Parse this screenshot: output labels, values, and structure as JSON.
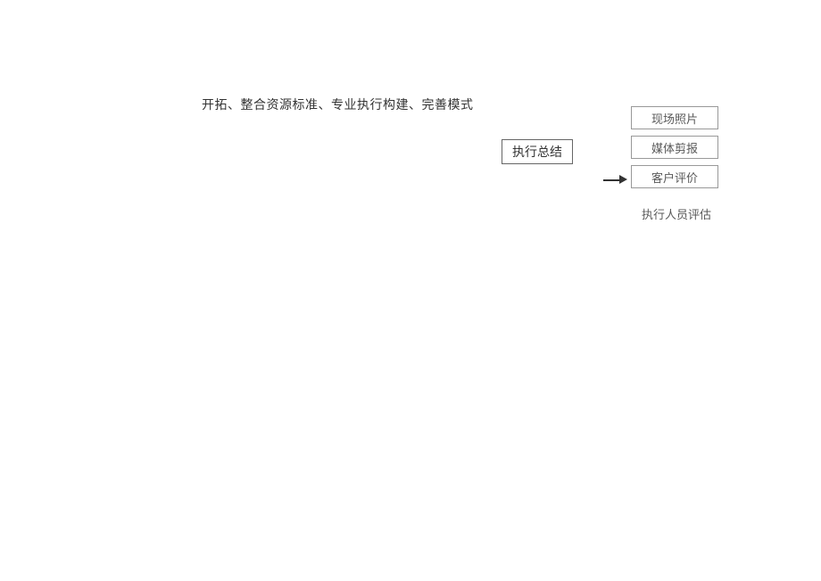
{
  "heading": "开拓、整合资源标准、专业执行构建、完善模式",
  "center_box": "执行总结",
  "right_boxes": {
    "box1": "现场照片",
    "box2": "媒体剪报",
    "box3": "客户评价"
  },
  "bottom_text": "执行人员评估"
}
